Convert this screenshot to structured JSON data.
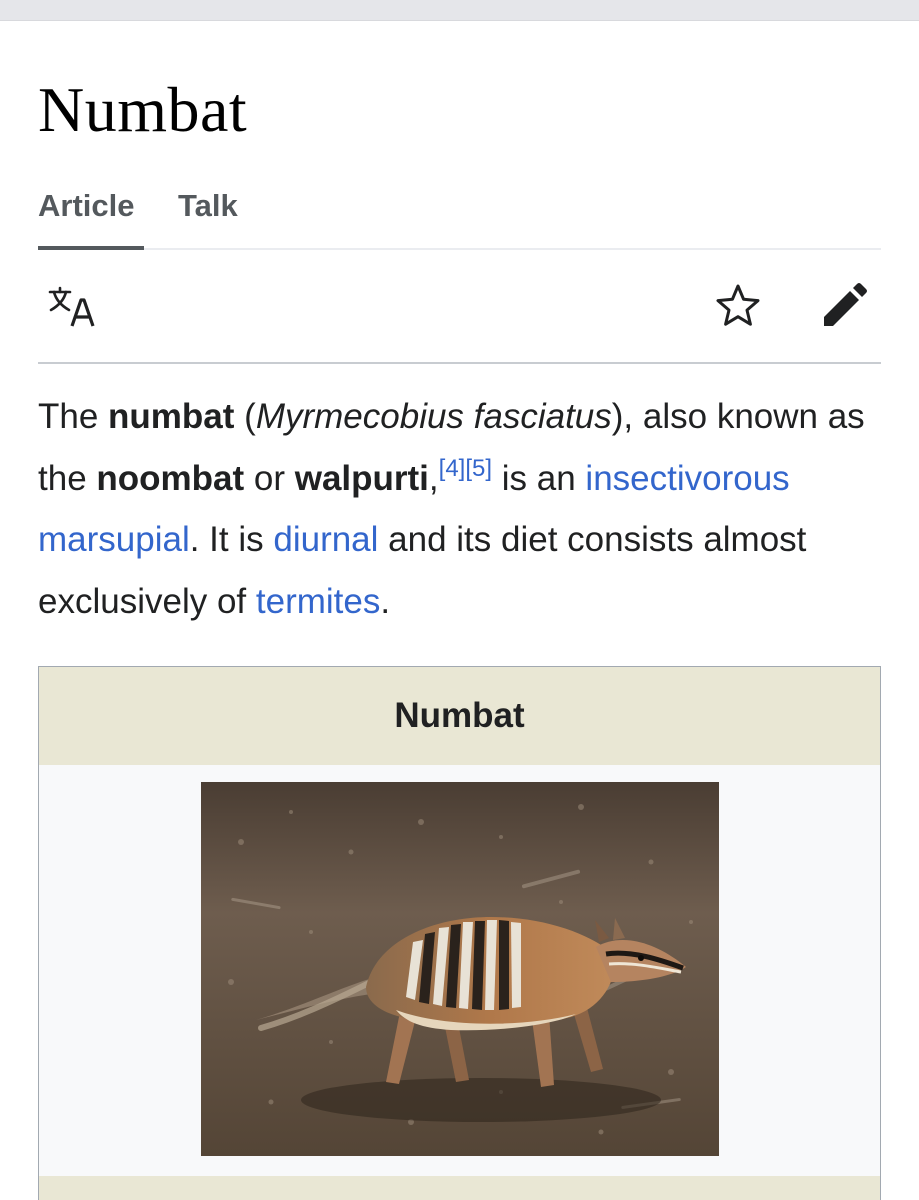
{
  "page": {
    "title": "Numbat"
  },
  "tabs": [
    {
      "label": "Article",
      "active": true
    },
    {
      "label": "Talk",
      "active": false
    }
  ],
  "toolbar": {
    "language_icon": "translate-icon",
    "watch_icon": "star-outline-icon",
    "edit_icon": "pencil-icon"
  },
  "lead": {
    "t1": "The ",
    "b1": "numbat",
    "t2": " (",
    "i1": "Myrmecobius fasciatus",
    "t3": "), also known as the ",
    "b2": "noombat",
    "t4": " or ",
    "b3": "walpurti",
    "t5": ",",
    "ref1": "[4]",
    "ref2": "[5]",
    "t6": " is an ",
    "link1": "insectivorous marsupial",
    "t7": ". It is ",
    "link2": "diurnal",
    "t8": " and its diet consists almost exclusively of ",
    "link3": "termites",
    "t9": "."
  },
  "infobox": {
    "title": "Numbat",
    "image_icon": "numbat-photo"
  },
  "colors": {
    "link": "#3366cc",
    "infobox_header": "#e9e7d4",
    "tab_text": "#54595d"
  }
}
